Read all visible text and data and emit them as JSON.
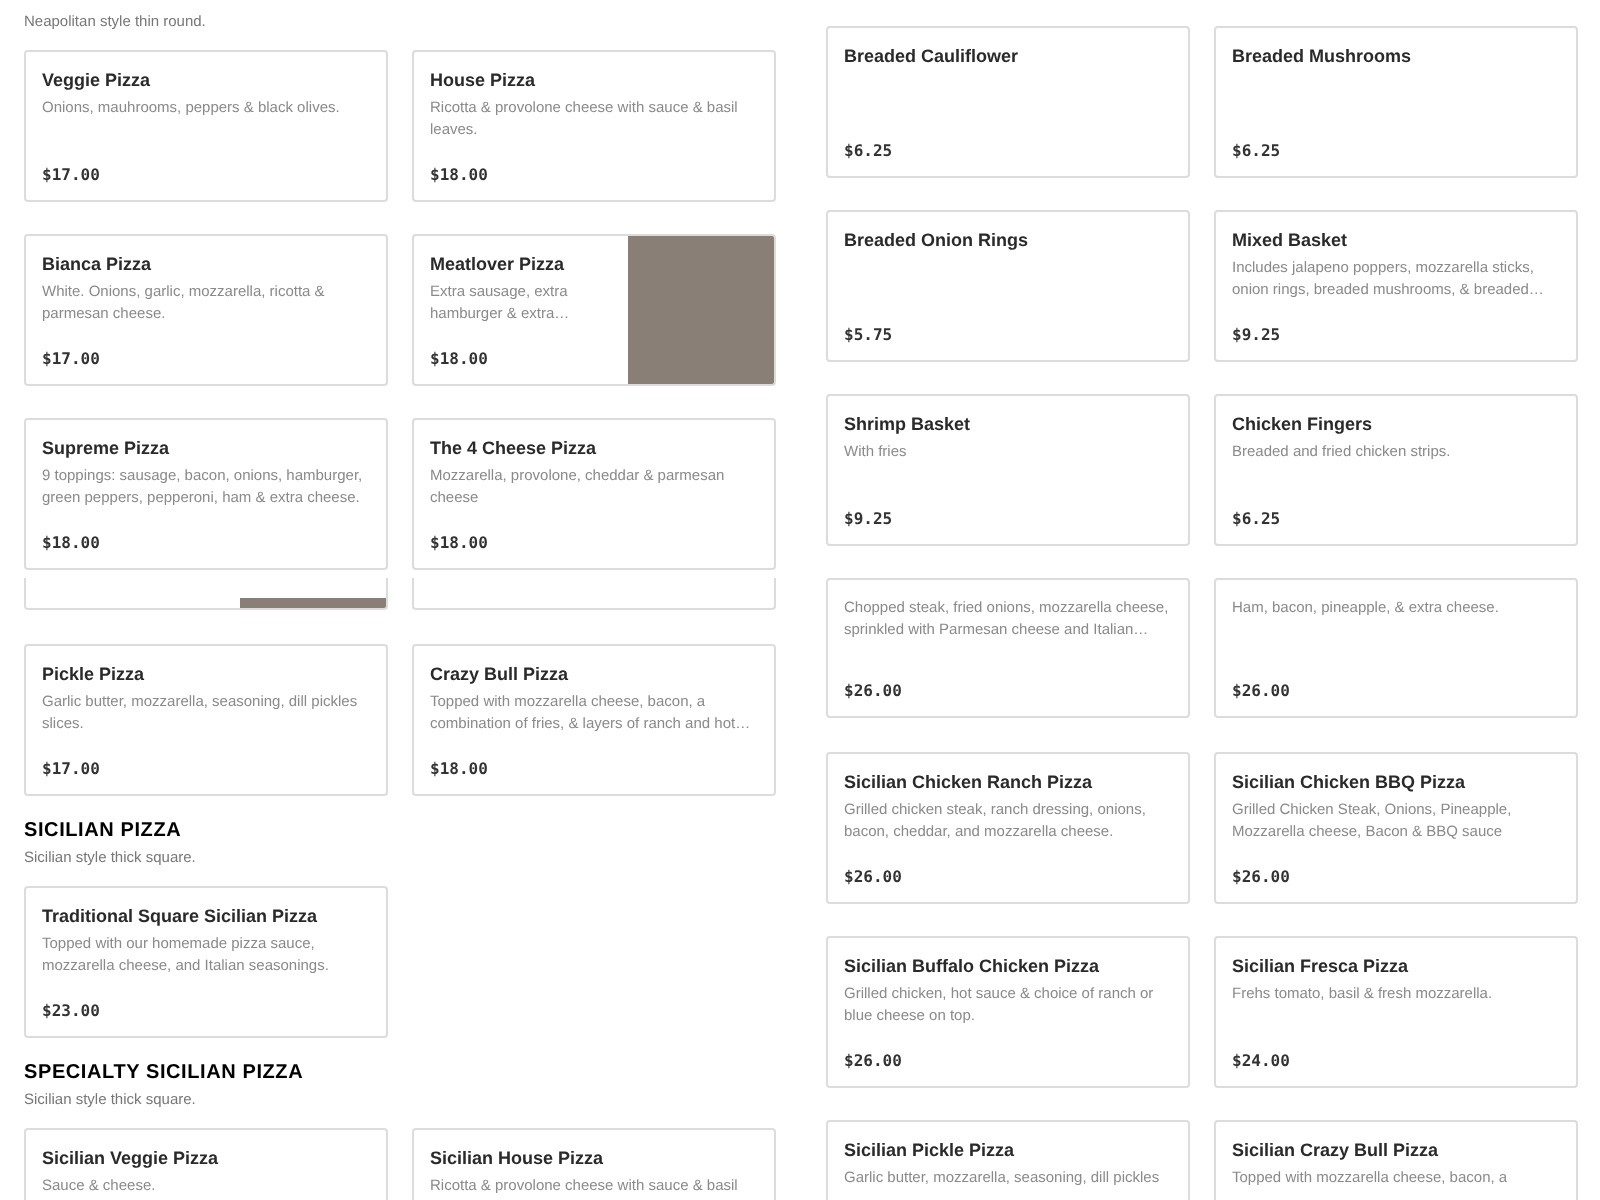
{
  "left_column": [
    {
      "kind": "subtitle",
      "text": "Neapolitan style thin round."
    },
    {
      "kind": "cards",
      "items": [
        {
          "name": "Veggie Pizza",
          "description": "Onions, mauhrooms, peppers & black olives.",
          "price": "$17.00",
          "photo": false
        },
        {
          "name": "House Pizza",
          "description": "Ricotta & provolone cheese with sauce & basil leaves.",
          "price": "$18.00",
          "photo": false
        }
      ]
    },
    {
      "kind": "cards",
      "items": [
        {
          "name": "Bianca Pizza",
          "description": "White. Onions, garlic, mozzarella, ricotta & parmesan cheese.",
          "price": "$17.00",
          "photo": false
        },
        {
          "name": "Meatlover Pizza",
          "description": "Extra sausage, extra hamburger & extra…",
          "price": "$18.00",
          "photo": true
        }
      ]
    },
    {
      "kind": "cards",
      "items": [
        {
          "name": "Supreme Pizza",
          "description": "9 toppings: sausage, bacon, onions, hamburger, green peppers, pepperoni, ham & extra cheese.",
          "price": "$18.00",
          "photo": false
        },
        {
          "name": "The 4 Cheese Pizza",
          "description": "Mozzarella, provolone, cheddar & parmesan cheese",
          "price": "$18.00",
          "photo": false
        }
      ]
    },
    {
      "kind": "fragment",
      "items": [
        {
          "photo": true
        },
        {
          "photo": false
        }
      ]
    },
    {
      "kind": "cards",
      "items": [
        {
          "name": "Pickle Pizza",
          "description": "Garlic butter, mozzarella, seasoning, dill pickles slices.",
          "price": "$17.00",
          "photo": false
        },
        {
          "name": "Crazy Bull Pizza",
          "description": "Topped with mozzarella cheese, bacon, a combination of fries, & layers of ranch and hot…",
          "price": "$18.00",
          "photo": false
        }
      ]
    },
    {
      "kind": "heading",
      "text": "SICILIAN PIZZA"
    },
    {
      "kind": "subtitle",
      "text": "Sicilian style thick square."
    },
    {
      "kind": "cards",
      "items": [
        {
          "name": "Traditional Square Sicilian Pizza",
          "description": "Topped with our homemade pizza sauce, mozzarella cheese, and Italian seasonings.",
          "price": "$23.00",
          "photo": false
        }
      ]
    },
    {
      "kind": "heading",
      "text": "SPECIALTY SICILIAN PIZZA"
    },
    {
      "kind": "subtitle",
      "text": "Sicilian style thick square."
    },
    {
      "kind": "cards",
      "items": [
        {
          "name": "Sicilian Veggie Pizza",
          "description": "Sauce & cheese.",
          "photo": false
        },
        {
          "name": "Sicilian House Pizza",
          "description": "Ricotta & provolone cheese with sauce & basil",
          "photo": false
        }
      ]
    }
  ],
  "right_column": [
    {
      "kind": "cards",
      "items": [
        {
          "name": "Breaded Cauliflower",
          "price": "$6.25",
          "photo": false
        },
        {
          "name": "Breaded Mushrooms",
          "price": "$6.25",
          "photo": false
        }
      ]
    },
    {
      "kind": "cards",
      "items": [
        {
          "name": "Breaded Onion Rings",
          "price": "$5.75",
          "photo": false
        },
        {
          "name": "Mixed Basket",
          "description": "Includes jalapeno poppers, mozzarella sticks, onion rings, breaded mushrooms, & breaded…",
          "price": "$9.25",
          "photo": false
        }
      ]
    },
    {
      "kind": "cards",
      "items": [
        {
          "name": "Shrimp Basket",
          "description": "With fries",
          "price": "$9.25",
          "photo": false
        },
        {
          "name": "Chicken Fingers",
          "description": "Breaded and fried chicken strips.",
          "price": "$6.25",
          "photo": false
        }
      ]
    },
    {
      "kind": "cut_cards",
      "items": [
        {
          "description": "Chopped steak, fried onions, mozzarella cheese, sprinkled with Parmesan cheese and Italian…",
          "price": "$26.00"
        },
        {
          "description": "Ham, bacon, pineapple, & extra cheese.",
          "price": "$26.00"
        }
      ]
    },
    {
      "kind": "cards",
      "items": [
        {
          "name": "Sicilian Chicken Ranch Pizza",
          "description": "Grilled chicken steak, ranch dressing, onions, bacon, cheddar, and mozzarella cheese.",
          "price": "$26.00",
          "photo": false
        },
        {
          "name": "Sicilian Chicken BBQ Pizza",
          "description": "Grilled Chicken Steak, Onions, Pineapple, Mozzarella cheese, Bacon & BBQ sauce",
          "price": "$26.00",
          "photo": false
        }
      ]
    },
    {
      "kind": "cards",
      "items": [
        {
          "name": "Sicilian Buffalo Chicken Pizza",
          "description": "Grilled chicken, hot sauce & choice of ranch or blue cheese on top.",
          "price": "$26.00",
          "photo": false
        },
        {
          "name": "Sicilian Fresca Pizza",
          "description": "Frehs tomato, basil & fresh mozzarella.",
          "price": "$24.00",
          "photo": false
        }
      ]
    },
    {
      "kind": "cards",
      "items": [
        {
          "name": "Sicilian Pickle Pizza",
          "description": "Garlic butter, mozzarella, seasoning, dill pickles",
          "photo": false
        },
        {
          "name": "Sicilian Crazy Bull Pizza",
          "description": "Topped with mozzarella cheese, bacon, a",
          "photo": false
        }
      ]
    }
  ]
}
